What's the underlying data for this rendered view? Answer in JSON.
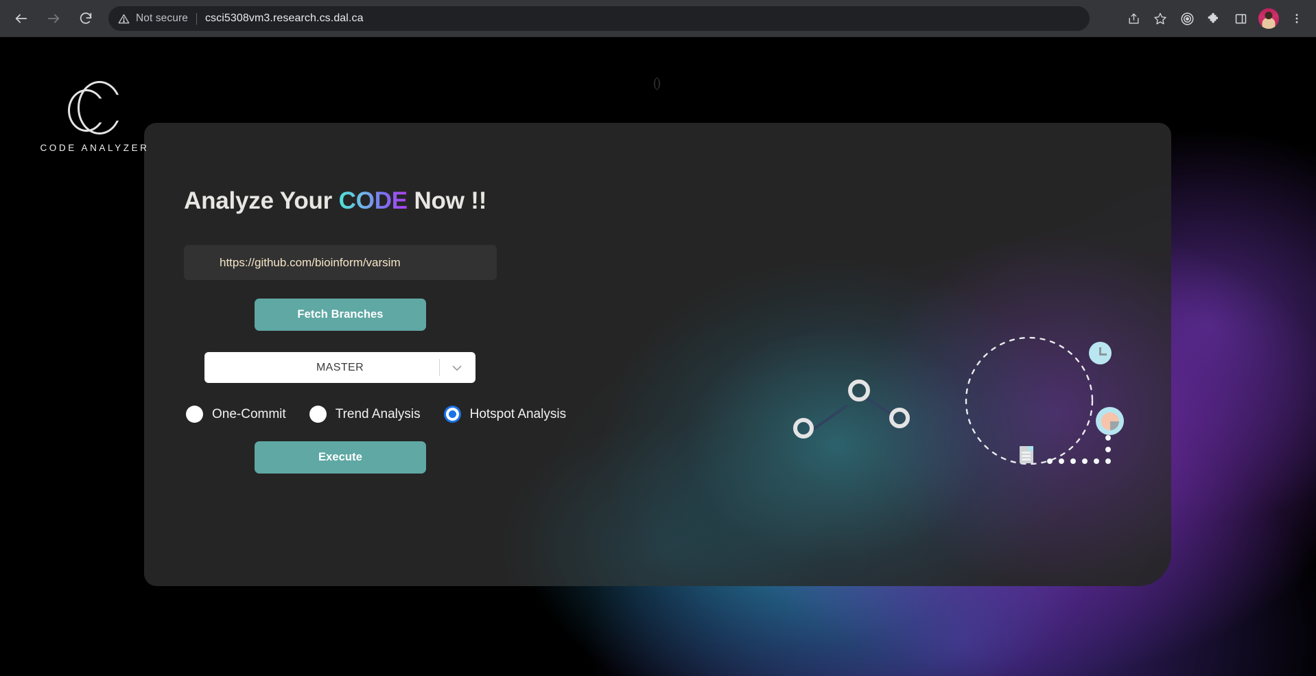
{
  "browser": {
    "back_icon": "back-arrow-icon",
    "forward_icon": "forward-arrow-icon",
    "reload_icon": "reload-icon",
    "security_label": "Not secure",
    "url": "csci5308vm3.research.cs.dal.ca",
    "toolbar_icons": [
      "share-icon",
      "bookmark-star-icon",
      "target-circle-icon",
      "extensions-puzzle-icon",
      "side-panel-icon",
      "profile-avatar",
      "chrome-menu-icon"
    ]
  },
  "brand": {
    "logo_mark": "code-analyzer-c-logo",
    "name": "CODE ANALYZER"
  },
  "main": {
    "headline_before": "Analyze Your ",
    "headline_accent": "CODE",
    "headline_after": " Now !!",
    "headline_accent_gradient_from": "#4fe0d8",
    "headline_accent_gradient_to": "#b13ff0",
    "repo_input": {
      "value": "https://github.com/bioinform/varsim",
      "placeholder": "https://github.com/bioinform/varsim"
    },
    "fetch_button": "Fetch Branches",
    "branch_select": {
      "selected": "MASTER",
      "options": [
        "MASTER"
      ],
      "chevron_icon": "chevron-down-icon"
    },
    "analysis_options": [
      {
        "label": "One-Commit",
        "checked": false
      },
      {
        "label": "Trend Analysis",
        "checked": false
      },
      {
        "label": "Hotspot Analysis",
        "checked": true
      }
    ],
    "execute_button": "Execute",
    "accent_button_color": "#5fa8a4",
    "radio_checked_color": "#1a73e8"
  },
  "decoration": {
    "icons": [
      "dashed-orbit-circle",
      "clock-badge-icon",
      "pie-chart-badge-icon",
      "network-node-graph",
      "document-icon",
      "dotted-path"
    ],
    "paren_mark": "()"
  }
}
